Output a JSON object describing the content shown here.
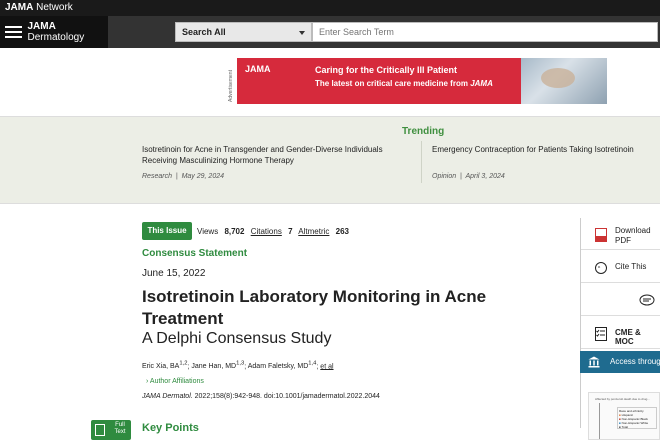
{
  "topbar": {
    "network_brand": "JAMA",
    "network_suffix": "Network"
  },
  "navbar": {
    "brand_journal": "JAMA",
    "brand_name": "Dermatology",
    "search_scope": "Search All",
    "search_placeholder": "Enter Search Term"
  },
  "ad": {
    "label": "Advertisement",
    "logo": "JAMA",
    "headline": "Caring for the Critically Ill Patient",
    "subline_prefix": "The latest on critical care medicine from",
    "subline_brand": "JAMA"
  },
  "trending": {
    "title": "Trending",
    "items": [
      {
        "title": "Isotretinoin for Acne in Transgender and Gender-Diverse Individuals Receiving Masculinizing Hormone Therapy",
        "category": "Research",
        "date": "May 29, 2024"
      },
      {
        "title": "Emergency Contraception for Patients Taking Isotretinoin",
        "category": "Opinion",
        "date": "April 3, 2024"
      }
    ]
  },
  "article": {
    "badge": "This Issue",
    "views_label": "Views",
    "views_value": "8,702",
    "citations_label": "Citations",
    "citations_value": "7",
    "altmetric_label": "Altmetric",
    "altmetric_value": "263",
    "type": "Consensus Statement",
    "date": "June 15, 2022",
    "title": "Isotretinoin Laboratory Monitoring in Acne Treatment",
    "subtitle": "A Delphi Consensus Study",
    "authors": [
      {
        "name": "Eric Xia, BA",
        "sup": "1,2"
      },
      {
        "name": "Jane Han, MD",
        "sup": "1,3"
      },
      {
        "name": "Adam Faletsky, MD",
        "sup": "1,4"
      }
    ],
    "et_al": "et al",
    "affiliations": "Author Affiliations",
    "citation_journal": "JAMA Dermatol.",
    "citation_rest": " 2022;158(8):942-948. doi:10.1001/jamadermatol.2022.2044",
    "full_text_line1": "Full",
    "full_text_line2": "Text",
    "key_points": "Key Points"
  },
  "rail": {
    "download_line1": "Download",
    "download_line2": "PDF",
    "cite": "Cite This",
    "cme": "CME & MOC",
    "access": "Access through"
  },
  "thumbnail": {
    "caption": "Affected by ponzeroli death due to drug...",
    "legend": [
      "Race and ethnicity",
      "Hispanic",
      "Non-Hispanic Black",
      "Non-Hispanic White",
      "Total"
    ]
  },
  "colors": {
    "green": "#2f8b3f",
    "ad_red": "#d62a3c",
    "access_blue": "#1f6b8f",
    "trending_bg": "#eceee6"
  }
}
